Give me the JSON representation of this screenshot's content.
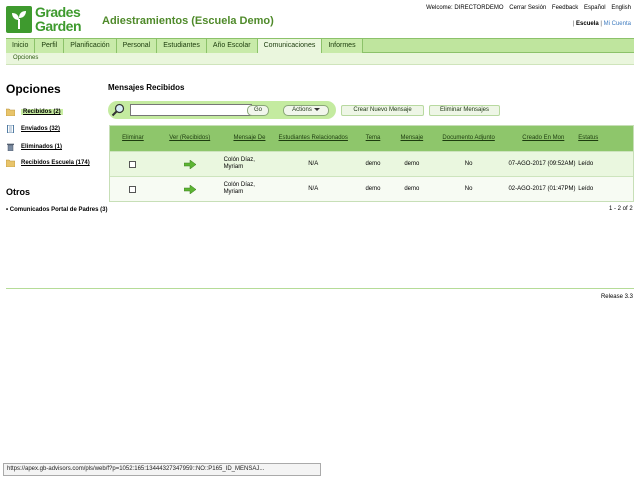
{
  "header": {
    "logo_line1": "Grades",
    "logo_line2": "Garden",
    "app_title": "Adiestramientos (Escuela Demo)",
    "top_links": [
      "Welcome: DIRECTORDEMO",
      "Cerrar Sesión",
      "Feedback",
      "Español",
      "English"
    ],
    "context_active": "Escuela",
    "context_separator": "|",
    "context_other": "Mi Cuenta"
  },
  "nav": {
    "tabs": [
      "Inicio",
      "Perfil",
      "Planificación",
      "Personal",
      "Estudiantes",
      "Año Escolar",
      "Comunicaciones",
      "Informes"
    ],
    "active_tab": "Comunicaciones",
    "subnav": "Opciones"
  },
  "sidebar": {
    "title": "Opciones",
    "items": [
      {
        "label": "Recibidos (2)",
        "icon": "folder-icon"
      },
      {
        "label": "Enviados (32)",
        "icon": "document-icon"
      },
      {
        "label": "Eliminados (1)",
        "icon": "trash-icon"
      },
      {
        "label": "Recibidos Escuela (174)",
        "icon": "folder-icon"
      }
    ],
    "others_title": "Otros",
    "others_item": "Comunicados Portal de Padres (3)"
  },
  "main": {
    "title": "Mensajes Recibidos",
    "search": {
      "value": "",
      "placeholder": ""
    },
    "go_label": "Go",
    "actions_label": "Actions",
    "create_label": "Crear Nuevo Mensaje",
    "delete_label": "Eliminar Mensajes"
  },
  "table": {
    "headers": [
      "Eliminar",
      "Ver (Recibidos)",
      "Mensaje De",
      "Estudiantes Relacionados",
      "Tema",
      "Mensaje",
      "Documento Adjunto",
      "Creado En Mon",
      "Estatus"
    ],
    "rows": [
      {
        "from": "Colón Díaz, Myriam",
        "students": "N/A",
        "topic": "demo",
        "message": "demo",
        "attachment": "No",
        "created": "07-AGO-2017 (09:52AM)",
        "status": "Leído"
      },
      {
        "from": "Colón Díaz, Myriam",
        "students": "N/A",
        "topic": "demo",
        "message": "demo",
        "attachment": "No",
        "created": "02-AGO-2017 (01:47PM)",
        "status": "Leído"
      }
    ],
    "pagination": "1 - 2 of 2"
  },
  "footer": {
    "release": "Release 3.3"
  },
  "statusbar": {
    "url": "https://apex.gb-advisors.com/pls/web/f?p=1052:165:13444327347959::NO::P165_ID_MENSAJ..."
  },
  "colors": {
    "brand": "#3e9a2e",
    "nav_bg": "#bfe59e",
    "table_header": "#8ec66b",
    "arrow": "#5cb532"
  }
}
